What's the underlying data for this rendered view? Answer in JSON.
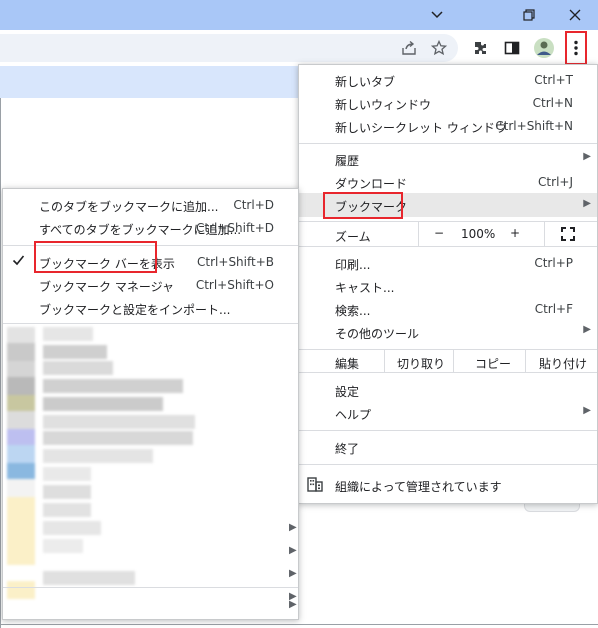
{
  "window": {
    "minimize_glyph": "⌄",
    "restore_glyph": "❐",
    "close_glyph": "✕"
  },
  "toolbar": {
    "icons": [
      "share-icon",
      "star-icon",
      "extensions-icon",
      "side-panel-icon",
      "avatar",
      "menu-kebab-icon"
    ]
  },
  "main_menu": {
    "new_tab": {
      "label": "新しいタブ",
      "shortcut": "Ctrl+T"
    },
    "new_window": {
      "label": "新しいウィンドウ",
      "shortcut": "Ctrl+N"
    },
    "new_incognito": {
      "label": "新しいシークレット ウィンドウ",
      "shortcut": "Ctrl+Shift+N"
    },
    "history": {
      "label": "履歴"
    },
    "downloads": {
      "label": "ダウンロード",
      "shortcut": "Ctrl+J"
    },
    "bookmarks": {
      "label": "ブックマーク"
    },
    "zoom": {
      "label": "ズーム",
      "minus": "−",
      "value": "100%",
      "plus": "+"
    },
    "print": {
      "label": "印刷...",
      "shortcut": "Ctrl+P"
    },
    "cast": {
      "label": "キャスト..."
    },
    "find": {
      "label": "検索...",
      "shortcut": "Ctrl+F"
    },
    "more_tools": {
      "label": "その他のツール"
    },
    "edit": {
      "label": "編集",
      "cut": "切り取り",
      "copy": "コピー",
      "paste": "貼り付け"
    },
    "settings": {
      "label": "設定"
    },
    "help": {
      "label": "ヘルプ"
    },
    "exit": {
      "label": "終了"
    },
    "managed": {
      "label": "組織によって管理されています"
    }
  },
  "bookmark_submenu": {
    "bookmark_tab": {
      "label": "このタブをブックマークに追加...",
      "shortcut": "Ctrl+D"
    },
    "bookmark_all": {
      "label": "すべてのタブをブックマークに追加...",
      "shortcut": "Ctrl+Shift+D"
    },
    "show_bar": {
      "label": "ブックマーク バーを表示",
      "shortcut": "Ctrl+Shift+B",
      "checked": true
    },
    "manager": {
      "label": "ブックマーク マネージャ",
      "shortcut": "Ctrl+Shift+O"
    },
    "import": {
      "label": "ブックマークと設定をインポート..."
    }
  },
  "colors": {
    "titlebar": "#a9c7f7",
    "highlight_box": "#e8262d",
    "hover": "#e8e8e8"
  }
}
